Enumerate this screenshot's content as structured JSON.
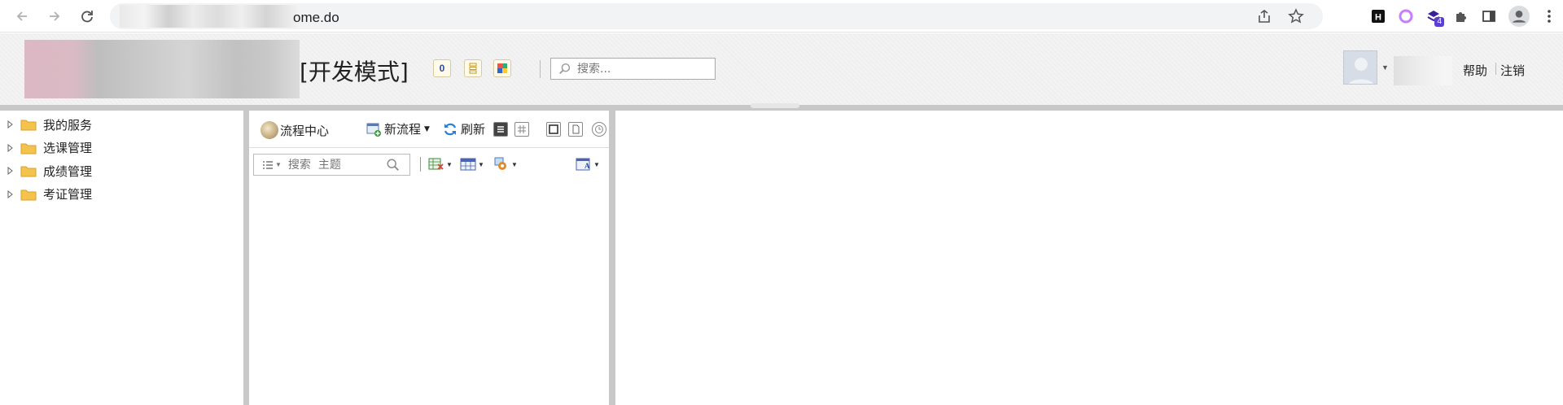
{
  "browser": {
    "url_visible": "ome.do",
    "icons": [
      "back-icon",
      "forward-icon",
      "reload-icon",
      "share-icon",
      "bookmark-star-icon"
    ],
    "extensions": [
      "h-extension-icon",
      "circle-extension-icon",
      "layers-extension-icon",
      "puzzle-icon",
      "sidepanel-icon",
      "profile-icon",
      "menu-kebab-icon"
    ],
    "ext_badge": "4"
  },
  "header": {
    "mode_label": "[开发模式]",
    "count_badge": "0",
    "search_placeholder": "搜索...",
    "help_label": "帮助",
    "logout_label": "注销"
  },
  "tree": {
    "items": [
      {
        "label": "我的服务"
      },
      {
        "label": "选课管理"
      },
      {
        "label": "成绩管理"
      },
      {
        "label": "考证管理"
      }
    ]
  },
  "workflow": {
    "title": "流程中心",
    "new_label": "新流程",
    "refresh_label": "刷新",
    "search_placeholder": "搜索  主题"
  },
  "colors": {
    "folder": "#f3c34d",
    "splitter": "#c8c8c8",
    "badge": "#5b3fd1"
  }
}
